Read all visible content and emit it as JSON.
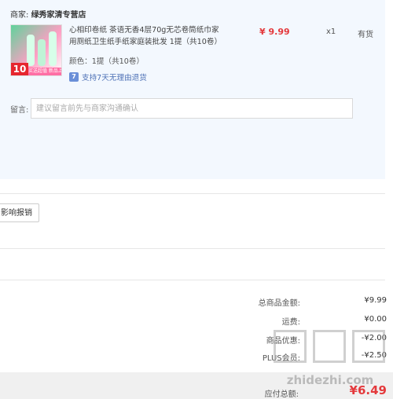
{
  "merchant": {
    "label": "商家:",
    "name": "绿秀家清专营店"
  },
  "product": {
    "title": "心相印卷纸 茶语无香4层70g无芯卷筒纸巾家用厕纸卫生纸手纸家庭装批发 1提（共10卷）",
    "color": "颜色：1提（共10卷）",
    "return_policy": "支持7天无理由退货",
    "return_icon_text": "7",
    "price": "¥ 9.99",
    "quantity": "x1",
    "stock": "有货",
    "thumb_badge": "10",
    "thumb_badge_text": "买送超值 新品上市"
  },
  "message": {
    "label": "留言:",
    "placeholder": "建议留言前先与商家沟通确认"
  },
  "invoice": {
    "button_label": "影响报销"
  },
  "summary": {
    "goods_total_label": "总商品金额:",
    "goods_total": "¥9.99",
    "shipping_label": "运费:",
    "shipping": "¥0.00",
    "store_discount_label": "商品优惠:",
    "store_discount": "-¥2.00",
    "plus_label": "PLUS会员:",
    "plus": "-¥2.50",
    "payable_label": "应付总额:",
    "payable": "¥6.49"
  },
  "watermark": {
    "text": "zhidezhi.com"
  },
  "colors": {
    "accent_red": "#e4393c",
    "panel_bg": "#f3f8fe",
    "link_blue": "#4b6fb5"
  }
}
